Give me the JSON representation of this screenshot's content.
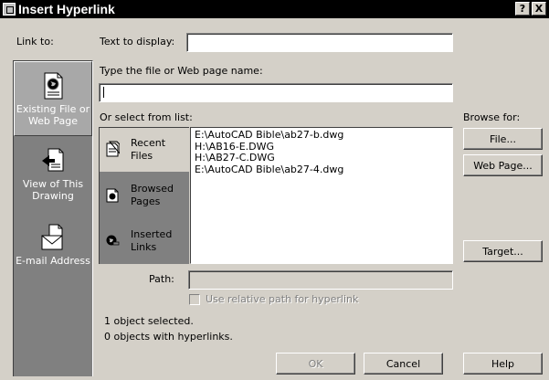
{
  "window": {
    "title": "Insert Hyperlink",
    "help_glyph": "?",
    "close_glyph": "X",
    "app_icon": "app-window-icon"
  },
  "link_to": {
    "label": "Link to:",
    "items": [
      {
        "label": "Existing File or Web Page",
        "icon": "document-globe-icon",
        "selected": true
      },
      {
        "label": "View of This Drawing",
        "icon": "drawing-view-icon",
        "selected": false
      },
      {
        "label": "E-mail Address",
        "icon": "email-envelope-icon",
        "selected": false
      }
    ]
  },
  "form": {
    "text_to_display_label": "Text to display:",
    "text_to_display_value": "",
    "file_or_web_label": "Type the file or Web page name:",
    "file_or_web_value": "",
    "select_from_list_label": "Or select from list:",
    "browse_for_label": "Browse for:",
    "browse_buttons": [
      "File...",
      "Web Page...",
      "Target..."
    ],
    "subtabs": [
      {
        "label": "Recent Files",
        "icon": "recent-files-icon",
        "selected": true
      },
      {
        "label": "Browsed Pages",
        "icon": "browsed-pages-icon",
        "selected": false
      },
      {
        "label": "Inserted Links",
        "icon": "inserted-links-icon",
        "selected": false
      }
    ],
    "recent_files": [
      "E:\\AutoCAD Bible\\ab27-b.dwg",
      "H:\\AB16-E.DWG",
      "H:\\AB27-C.DWG",
      "E:\\AutoCAD Bible\\ab27-4.dwg"
    ],
    "path_label": "Path:",
    "path_value": "",
    "relative_path_label": "Use relative path for hyperlink",
    "relative_path_checked": false,
    "status_line1": "1 object selected.",
    "status_line2": "0 objects with hyperlinks."
  },
  "buttons": {
    "ok": "OK",
    "cancel": "Cancel",
    "help": "Help"
  },
  "colors": {
    "titlebar": "#000000",
    "dialog_bg": "#d4d0c8",
    "panel_bg": "#808080"
  }
}
